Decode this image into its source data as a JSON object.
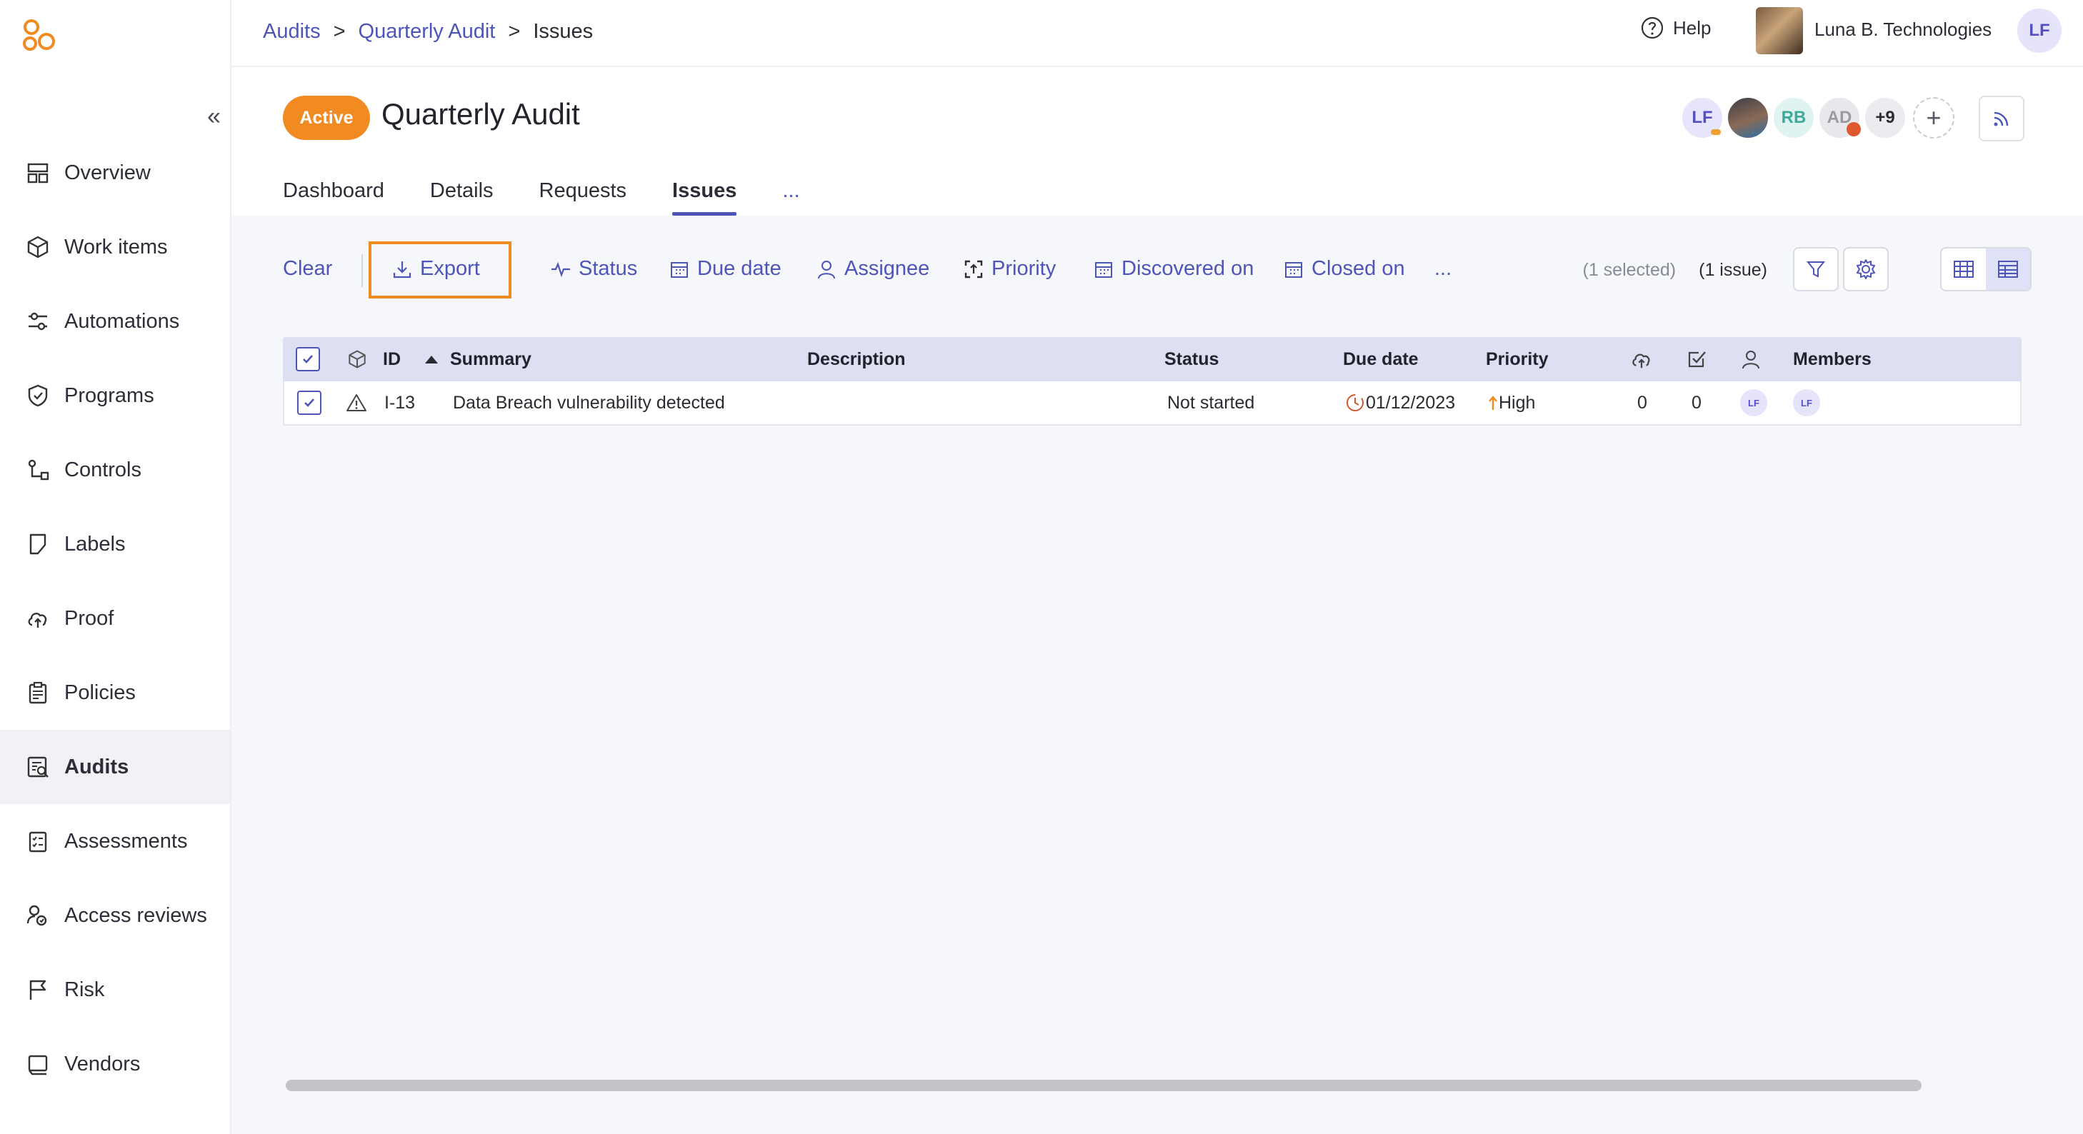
{
  "breadcrumb": {
    "root": "Audits",
    "parent": "Quarterly Audit",
    "current": "Issues",
    "sep1": ">",
    "sep2": ">"
  },
  "header": {
    "help_label": "Help",
    "org_name": "Luna B. Technologies",
    "user_initials": "LF"
  },
  "sidebar": {
    "items": [
      {
        "label": "Overview",
        "icon": "overview-icon"
      },
      {
        "label": "Work items",
        "icon": "cube-icon"
      },
      {
        "label": "Automations",
        "icon": "automation-icon"
      },
      {
        "label": "Programs",
        "icon": "shield-icon"
      },
      {
        "label": "Controls",
        "icon": "controls-icon"
      },
      {
        "label": "Labels",
        "icon": "label-icon"
      },
      {
        "label": "Proof",
        "icon": "cloud-upload-icon"
      },
      {
        "label": "Policies",
        "icon": "clipboard-icon"
      },
      {
        "label": "Audits",
        "icon": "audit-icon",
        "active": true
      },
      {
        "label": "Assessments",
        "icon": "checklist-icon"
      },
      {
        "label": "Access reviews",
        "icon": "access-review-icon"
      },
      {
        "label": "Risk",
        "icon": "flag-icon"
      },
      {
        "label": "Vendors",
        "icon": "vendor-icon"
      }
    ]
  },
  "page": {
    "status": "Active",
    "title": "Quarterly Audit",
    "members": [
      "LF",
      "",
      "RB",
      "AD",
      "+9"
    ],
    "tabs": [
      "Dashboard",
      "Details",
      "Requests",
      "Issues",
      "..."
    ],
    "active_tab": "Issues"
  },
  "toolbar": {
    "clear": "Clear",
    "export": "Export",
    "status": "Status",
    "due_date": "Due date",
    "assignee": "Assignee",
    "priority": "Priority",
    "discovered_on": "Discovered on",
    "closed_on": "Closed on",
    "more": "...",
    "selected_count": "(1 selected)",
    "issue_count": "(1 issue)"
  },
  "table": {
    "columns": {
      "id": "ID",
      "summary": "Summary",
      "description": "Description",
      "status": "Status",
      "due_date": "Due date",
      "priority": "Priority",
      "members": "Members"
    },
    "rows": [
      {
        "id": "I-13",
        "summary": "Data Breach vulnerability detected",
        "description": "",
        "status": "Not started",
        "due_date": "01/12/2023",
        "priority": "High",
        "proof_count": "0",
        "task_count": "0",
        "assignee": "LF",
        "member": "LF"
      }
    ]
  },
  "colors": {
    "accent": "#4d55b8",
    "active_orange": "#f28a22",
    "header_row": "#dde0f3"
  }
}
